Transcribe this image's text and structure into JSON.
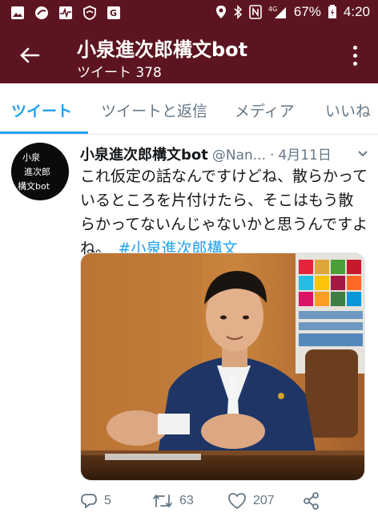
{
  "status_bar": {
    "battery": "67%",
    "time": "4:20",
    "network": "4G"
  },
  "header": {
    "title": "小泉進次郎構文bot",
    "subtitle": "ツイート 378"
  },
  "tabs": [
    {
      "label": "ツイート",
      "active": true
    },
    {
      "label": "ツイートと返信",
      "active": false
    },
    {
      "label": "メディア",
      "active": false
    },
    {
      "label": "いいね",
      "active": false
    }
  ],
  "tweet": {
    "display_name": "小泉進次郎構文bot",
    "handle": "@Nan...",
    "separator": "·",
    "date": "4月11日",
    "text": "これ仮定の話なんですけどね、散らかっているところを片付けたら、そこはもう散らかってないんじゃないかと思うんですよね。",
    "hashtag": "#小泉進次郎構文",
    "avatar_lines": [
      "小泉",
      "進次郎",
      "構文bot"
    ],
    "replies": "5",
    "retweets": "63",
    "likes": "207"
  },
  "colors": {
    "header_bg": "#5c1520",
    "accent": "#1da1f2",
    "muted": "#657786"
  }
}
